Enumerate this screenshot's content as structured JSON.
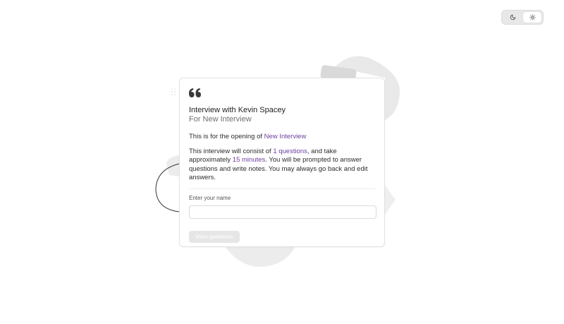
{
  "theme_toggle": {
    "dark_icon": "moon-icon",
    "light_icon": "sun-icon",
    "active": "light"
  },
  "card": {
    "quote_icon": "quote-icon",
    "title": "Interview with Kevin Spacey",
    "subtitle": "For New Interview",
    "opening_prefix": "This is for the opening of ",
    "opening_link": "New Interview",
    "details_prefix": "This interview will consist of ",
    "question_count": "1 questions",
    "details_middle": ", and take approximately ",
    "duration": "15 minutes",
    "details_suffix": ". You will be prompted to answer questions and write notes. You may always go back and edit answers.",
    "name_label": "Enter your name",
    "name_value": "",
    "name_placeholder": "",
    "view_button": "View questions"
  },
  "colors": {
    "accent": "#6b3fa0",
    "button_disabled": "#e6e6e6"
  }
}
